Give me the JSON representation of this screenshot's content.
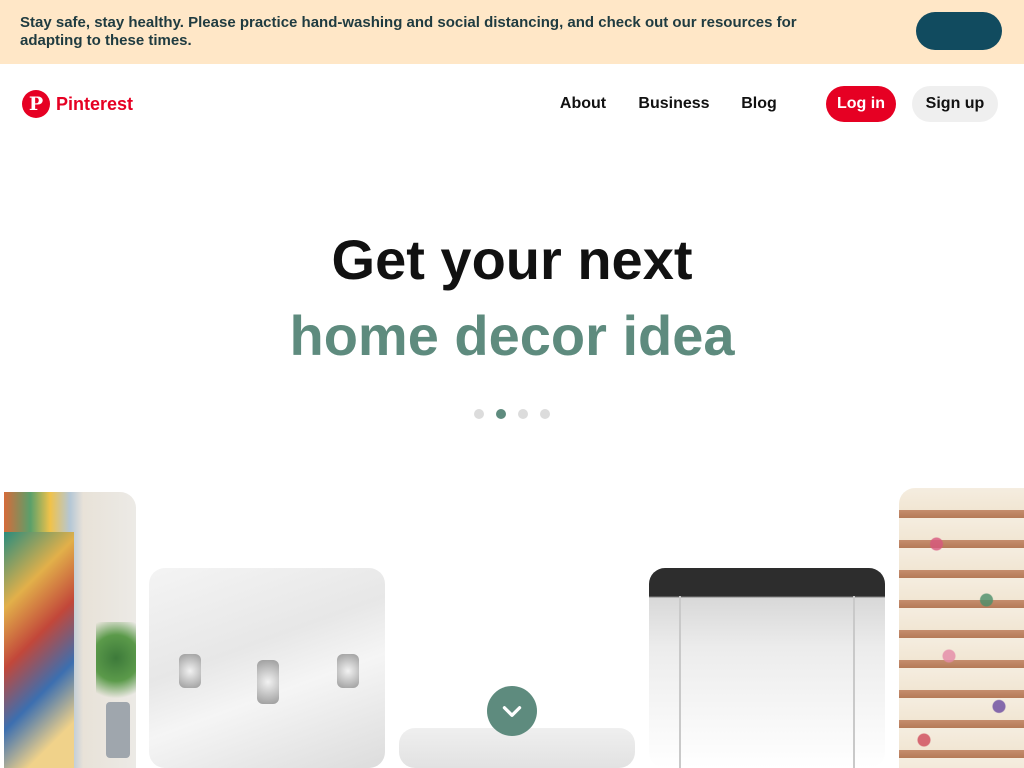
{
  "banner": {
    "text": "Stay safe, stay healthy. Please practice hand-washing and social distancing, and check out our resources for adapting to these times.",
    "button_label": ""
  },
  "header": {
    "logo_icon": "pinterest-logo-icon",
    "logo_text": "Pinterest",
    "nav": {
      "about": "About",
      "business": "Business",
      "blog": "Blog"
    },
    "login": "Log in",
    "signup": "Sign up"
  },
  "hero": {
    "title": "Get your next",
    "subtitle": "home decor idea"
  },
  "carousel": {
    "dot_count": 4,
    "active_index": 1
  },
  "scroll_button_icon": "chevron-down-icon",
  "colors": {
    "brand_red": "#e60023",
    "accent_green": "#5e8b7e",
    "banner_bg": "#ffe7c7",
    "banner_button": "#114b5f"
  }
}
